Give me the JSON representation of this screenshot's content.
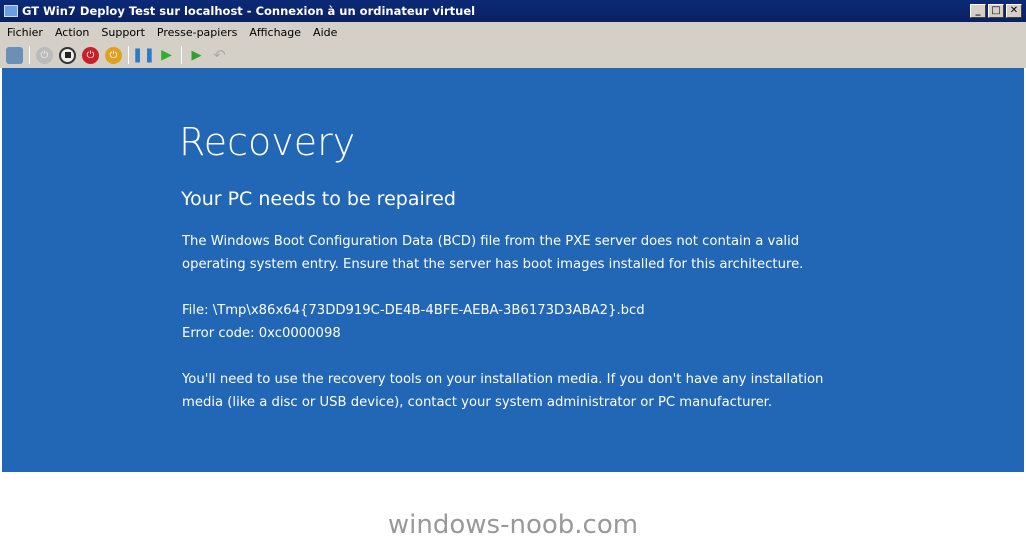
{
  "window": {
    "title": "GT Win7 Deploy Test sur localhost - Connexion à un ordinateur virtuel",
    "controls": [
      "_",
      "□",
      "✕"
    ]
  },
  "menu": [
    "Fichier",
    "Action",
    "Support",
    "Presse-papiers",
    "Affichage",
    "Aide"
  ],
  "toolbar": [
    "ctrl-alt-del-icon",
    "start-icon",
    "turn-off-icon",
    "shutdown-icon",
    "save-icon",
    "pause-icon",
    "reset-icon",
    "snapshot-icon",
    "revert-icon"
  ],
  "screen": {
    "title": "Recovery",
    "subtitle": "Your PC needs to be repaired",
    "para1": [
      "The Windows Boot Configuration Data (BCD) file from the PXE server does not contain a valid",
      "operating system entry. Ensure that the server has boot images installed for this architecture."
    ],
    "file": "File: \\Tmp\\x86x64{73DD919C-DE4B-4BFE-AEBA-3B6173D3ABA2}.bcd",
    "error": "Error code: 0xc0000098",
    "para2": [
      "You'll need to use the recovery tools on your installation media. If you don't have any installation",
      "media (like a disc or USB device), contact your system administrator or PC manufacturer."
    ],
    "background": "#2266b6"
  },
  "watermark": "windows-noob.com"
}
